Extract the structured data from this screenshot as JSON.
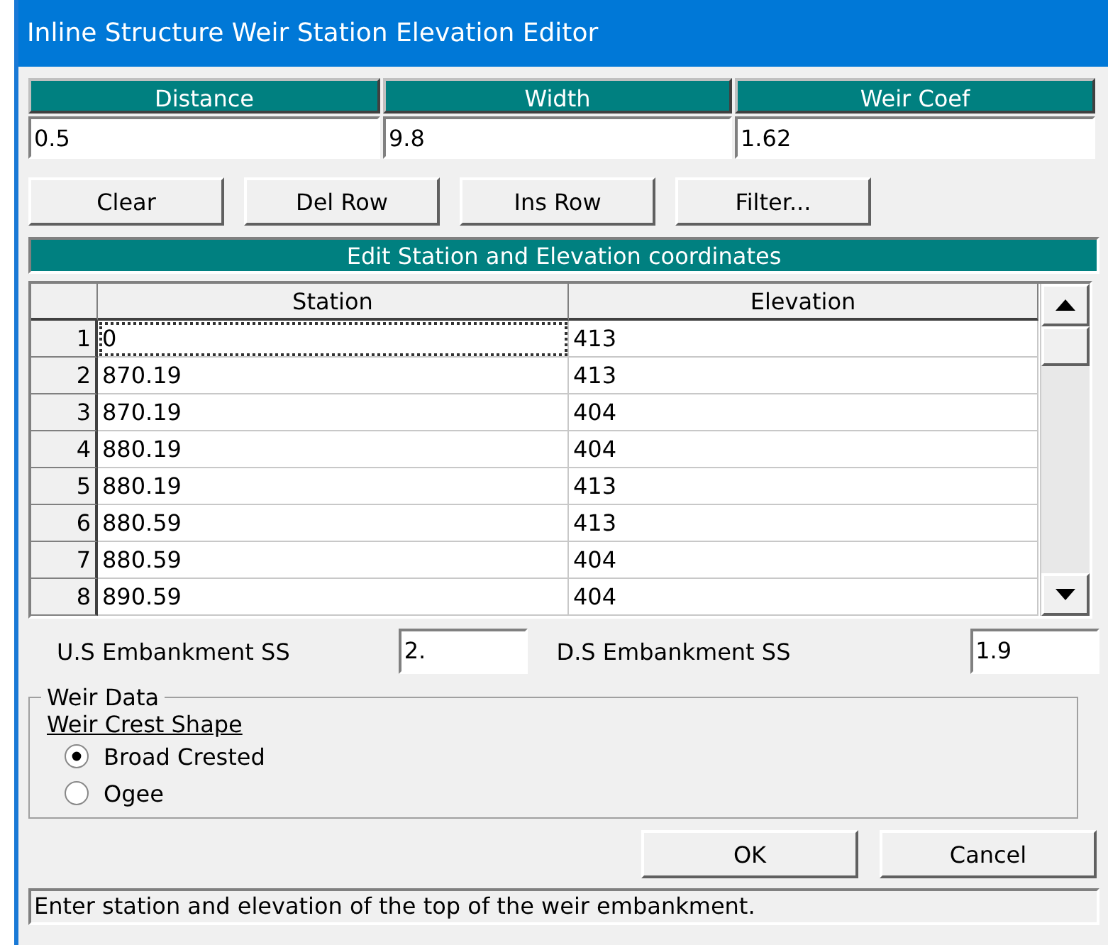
{
  "window": {
    "title": "Inline Structure Weir Station Elevation Editor"
  },
  "weir_table": {
    "columns": [
      "Distance",
      "Width",
      "Weir Coef"
    ],
    "values": [
      "0.5",
      "9.8",
      "1.62"
    ]
  },
  "buttons": [
    "Clear",
    "Del Row",
    "Ins Row",
    "Filter..."
  ],
  "coordinates": {
    "title": "Edit Station and Elevation coordinates",
    "columns": [
      "Station",
      "Elevation"
    ],
    "rows": [
      {
        "number": "1",
        "station": "0",
        "elevation": "413",
        "focused": true
      },
      {
        "number": "2",
        "station": "870.19",
        "elevation": "413",
        "focused": false
      },
      {
        "number": "3",
        "station": "870.19",
        "elevation": "404",
        "focused": false
      },
      {
        "number": "4",
        "station": "880.19",
        "elevation": "404",
        "focused": false
      },
      {
        "number": "5",
        "station": "880.19",
        "elevation": "413",
        "focused": false
      },
      {
        "number": "6",
        "station": "880.59",
        "elevation": "413",
        "focused": false
      },
      {
        "number": "7",
        "station": "880.59",
        "elevation": "404",
        "focused": false
      },
      {
        "number": "8",
        "station": "890.59",
        "elevation": "404",
        "focused": false
      }
    ]
  },
  "embankment": [
    {
      "label": "U.S Embankment SS",
      "value": "2."
    },
    {
      "label": "D.S Embankment SS",
      "value": "1.9"
    }
  ],
  "weir_data": {
    "title": "Weir Data",
    "shape_label": "Weir Crest Shape",
    "options": [
      {
        "label": "Broad Crested",
        "selected": true
      },
      {
        "label": "Ogee",
        "selected": false
      }
    ]
  },
  "dialog_buttons": [
    "OK",
    "Cancel"
  ],
  "status_bar": "Enter station and elevation of the top of the weir embankment."
}
